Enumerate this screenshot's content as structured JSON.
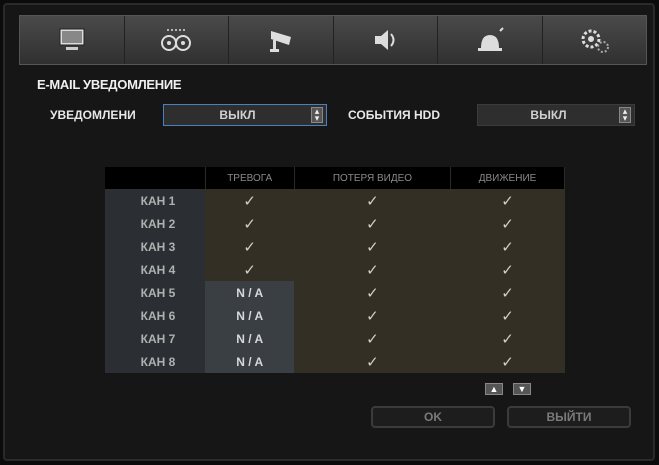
{
  "toolbar": {
    "items": [
      {
        "icon": "monitor-icon"
      },
      {
        "icon": "record-reels-icon"
      },
      {
        "icon": "cctv-camera-icon"
      },
      {
        "icon": "speaker-icon"
      },
      {
        "icon": "alarm-siren-icon"
      },
      {
        "icon": "settings-gears-icon"
      }
    ]
  },
  "section": {
    "title": "E-MAIL УВЕДОМЛЕНИЕ"
  },
  "notify": {
    "label": "УВЕДОМЛЕНИ",
    "value": "ВЫКЛ"
  },
  "hdd": {
    "label": "СОБЫТИЯ HDD",
    "value": "ВЫКЛ"
  },
  "table": {
    "headers": [
      "",
      "ТРЕВОГА",
      "ПОТЕРЯ ВИДЕО",
      "ДВИЖЕНИЕ"
    ],
    "rows": [
      {
        "channel": "КАН 1",
        "alarm": "✓",
        "video_loss": "✓",
        "motion": "✓"
      },
      {
        "channel": "КАН 2",
        "alarm": "✓",
        "video_loss": "✓",
        "motion": "✓"
      },
      {
        "channel": "КАН 3",
        "alarm": "✓",
        "video_loss": "✓",
        "motion": "✓"
      },
      {
        "channel": "КАН 4",
        "alarm": "✓",
        "video_loss": "✓",
        "motion": "✓"
      },
      {
        "channel": "КАН 5",
        "alarm": "N / A",
        "video_loss": "✓",
        "motion": "✓"
      },
      {
        "channel": "КАН 6",
        "alarm": "N / A",
        "video_loss": "✓",
        "motion": "✓"
      },
      {
        "channel": "КАН 7",
        "alarm": "N / A",
        "video_loss": "✓",
        "motion": "✓"
      },
      {
        "channel": "КАН 8",
        "alarm": "N / A",
        "video_loss": "✓",
        "motion": "✓"
      }
    ]
  },
  "pager": {
    "up": "▲",
    "down": "▼"
  },
  "buttons": {
    "ok": "OK",
    "exit": "ВЫЙТИ"
  },
  "colors": {
    "accent": "#4a80c0",
    "cell": "#332f24",
    "na_cell": "#3a3f44"
  }
}
